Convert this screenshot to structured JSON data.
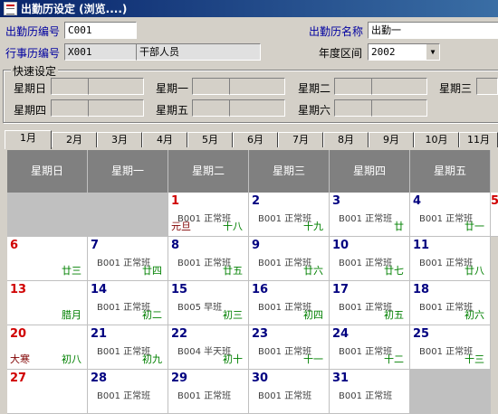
{
  "window": {
    "title": "出勤历设定  (浏览....)"
  },
  "form": {
    "code_label": "出勤历编号",
    "code_value": "C001",
    "name_label": "出勤历名称",
    "name_value": "出勤一",
    "calendar_label": "行事历编号",
    "calendar_value": "X001",
    "calendar_desc": "干部人员",
    "year_label": "年度区间",
    "year_value": "2002"
  },
  "quick": {
    "title": "快速设定",
    "days": [
      "星期日",
      "星期一",
      "星期二",
      "星期三",
      "星期四",
      "星期五",
      "星期六"
    ]
  },
  "tabs": [
    "1月",
    "2月",
    "3月",
    "4月",
    "5月",
    "6月",
    "7月",
    "8月",
    "9月",
    "10月",
    "11月"
  ],
  "calendar": {
    "headers": [
      "星期日",
      "星期一",
      "星期二",
      "星期三",
      "星期四",
      "星期五"
    ],
    "partial_next": "5",
    "cells": [
      {
        "blank": true
      },
      {
        "blank": true
      },
      {
        "day": "1",
        "red": true,
        "shift": "B001  正常班",
        "lunar": "十八",
        "fest": "元旦"
      },
      {
        "day": "2",
        "shift": "B001  正常班",
        "lunar": "十九"
      },
      {
        "day": "3",
        "shift": "B001  正常班",
        "lunar": "廿"
      },
      {
        "day": "4",
        "shift": "B001  正常班",
        "lunar": "廿一"
      },
      {
        "day": "6",
        "red": true,
        "lunar": "廿三"
      },
      {
        "day": "7",
        "shift": "B001  正常班",
        "lunar": "廿四"
      },
      {
        "day": "8",
        "shift": "B001  正常班",
        "lunar": "廿五"
      },
      {
        "day": "9",
        "shift": "B001  正常班",
        "lunar": "廿六"
      },
      {
        "day": "10",
        "shift": "B001  正常班",
        "lunar": "廿七"
      },
      {
        "day": "11",
        "shift": "B001  正常班",
        "lunar": "廿八"
      },
      {
        "day": "13",
        "red": true,
        "lunar": "腊月"
      },
      {
        "day": "14",
        "shift": "B001  正常班",
        "lunar": "初二"
      },
      {
        "day": "15",
        "shift": "B005  早班",
        "lunar": "初三"
      },
      {
        "day": "16",
        "shift": "B001  正常班",
        "lunar": "初四"
      },
      {
        "day": "17",
        "shift": "B001  正常班",
        "lunar": "初五"
      },
      {
        "day": "18",
        "shift": "B001  正常班",
        "lunar": "初六"
      },
      {
        "day": "20",
        "red": true,
        "lunar": "初八",
        "fest": "大寒"
      },
      {
        "day": "21",
        "shift": "B001  正常班",
        "lunar": "初九"
      },
      {
        "day": "22",
        "shift": "B004  半天班",
        "lunar": "初十"
      },
      {
        "day": "23",
        "shift": "B001  正常班",
        "lunar": "十一"
      },
      {
        "day": "24",
        "shift": "B001  正常班",
        "lunar": "十二"
      },
      {
        "day": "25",
        "shift": "B001  正常班",
        "lunar": "十三"
      },
      {
        "day": "27",
        "red": true,
        "lunar": ""
      },
      {
        "day": "28",
        "shift": "B001  正常班",
        "lunar": ""
      },
      {
        "day": "29",
        "shift": "B001  正常班",
        "lunar": ""
      },
      {
        "day": "30",
        "shift": "B001  正常班",
        "lunar": ""
      },
      {
        "day": "31",
        "shift": "B001  正常班",
        "lunar": ""
      },
      {
        "blank": true
      }
    ]
  }
}
